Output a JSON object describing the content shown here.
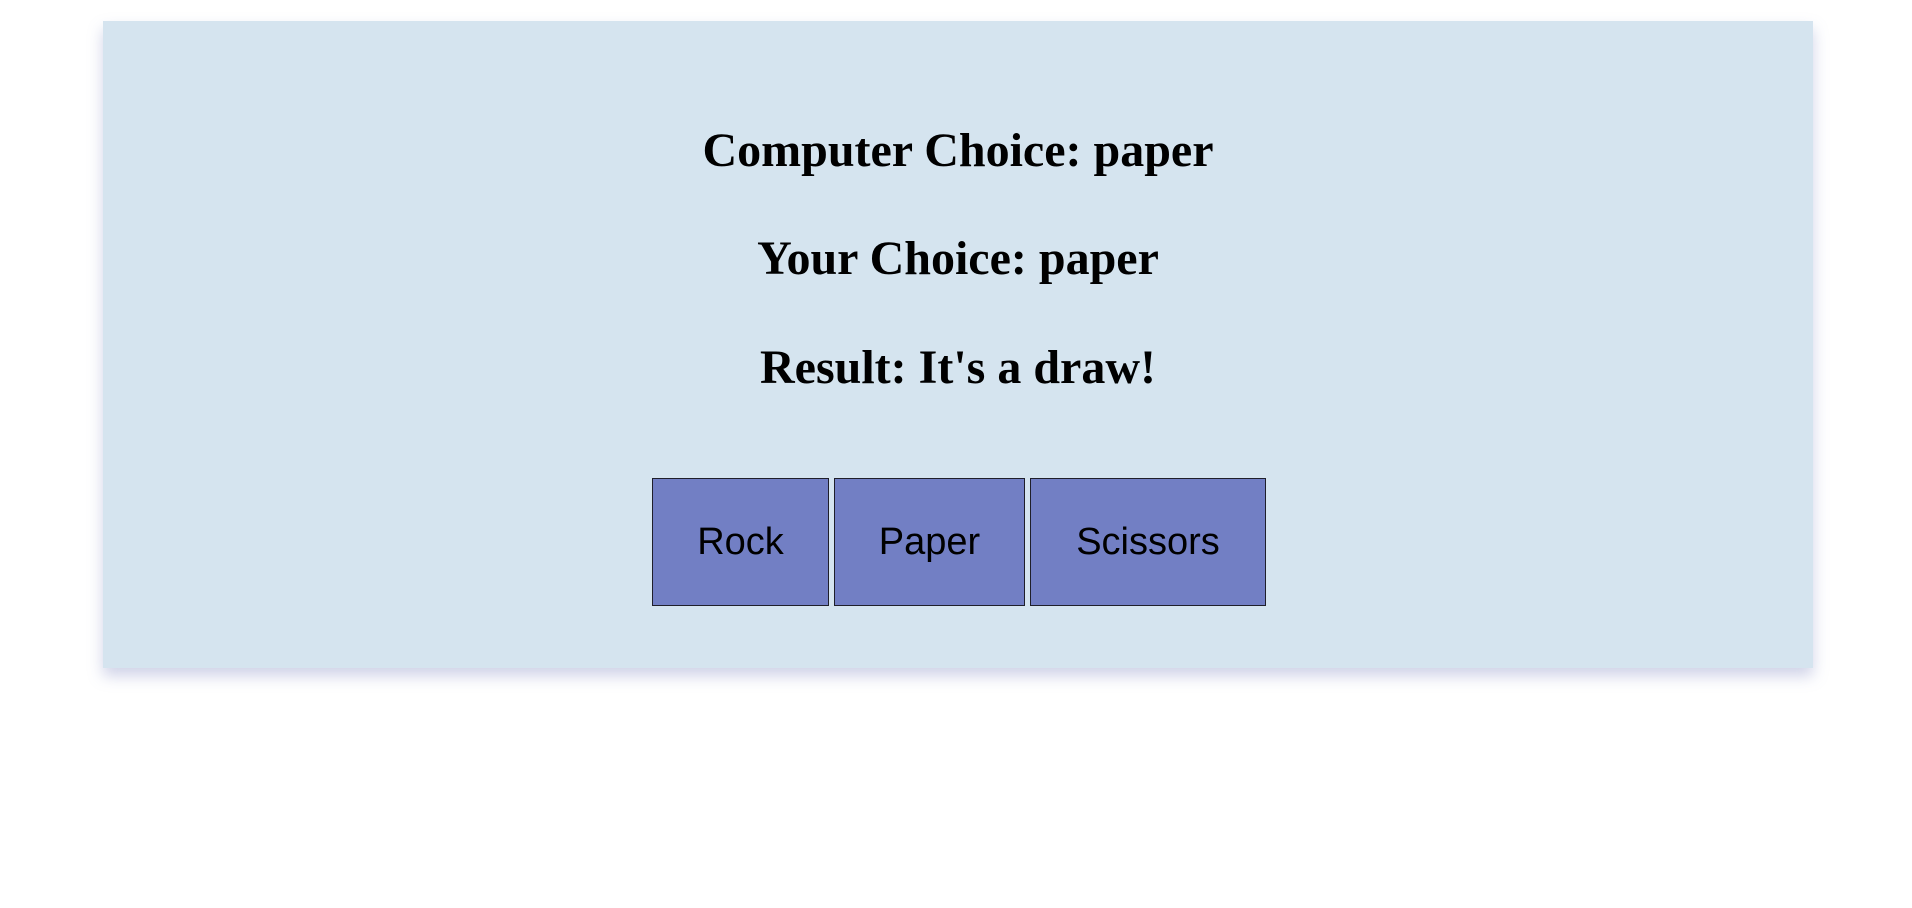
{
  "game": {
    "computer_choice_text": "Computer Choice: paper",
    "your_choice_text": "Your Choice: paper",
    "result_text": "Result: It's a draw!"
  },
  "buttons": {
    "rock_label": "Rock",
    "paper_label": "Paper",
    "scissors_label": "Scissors"
  },
  "colors": {
    "panel_background": "#d5e4ef",
    "button_background": "#727fc4",
    "text": "#000000"
  }
}
